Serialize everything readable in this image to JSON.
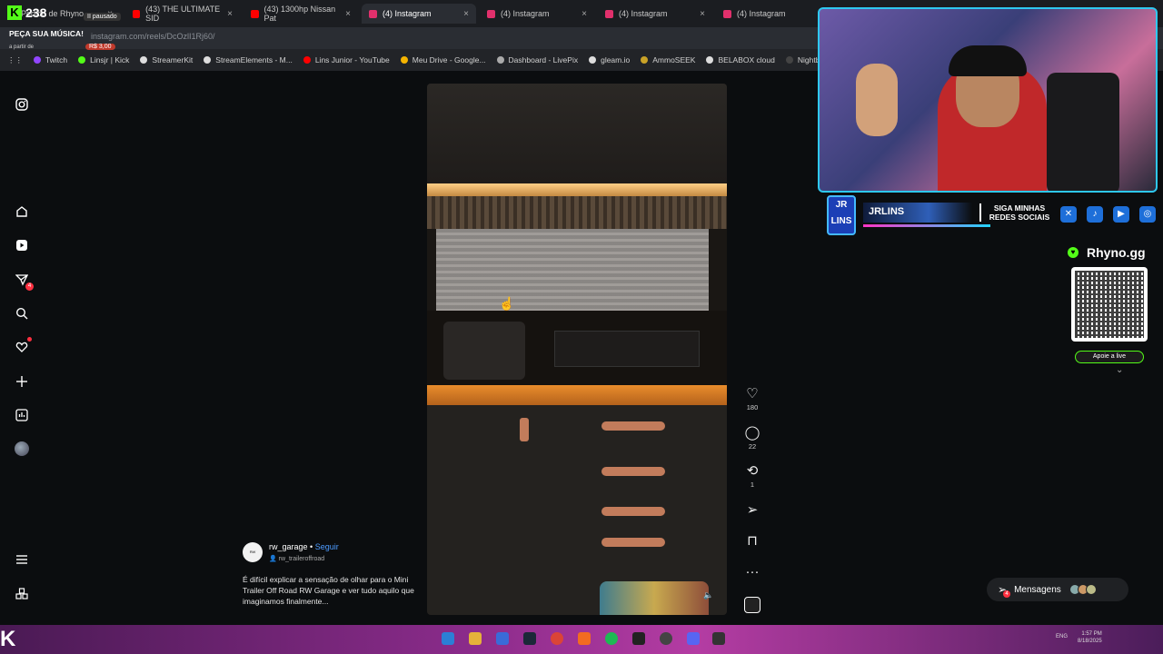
{
  "tabs": [
    {
      "label": "Pedido de Rhyno",
      "color": "#53fc18",
      "active": false
    },
    {
      "label": "(43) THE ULTIMATE SID",
      "color": "#ff0000",
      "active": false
    },
    {
      "label": "(43) 1300hp Nissan Pat",
      "color": "#ff0000",
      "active": false
    },
    {
      "label": "(4) Instagram",
      "color": "#e1306c",
      "active": true
    },
    {
      "label": "(4) Instagram",
      "color": "#e1306c",
      "active": false
    },
    {
      "label": "(4) Instagram",
      "color": "#e1306c",
      "active": false
    },
    {
      "label": "(4) Instagram",
      "color": "#e1306c",
      "active": false
    }
  ],
  "url": "instagram.com/reels/DcOzlI1Rj60/",
  "bookmarks": [
    "Twitch",
    "Linsjr | Kick",
    "StreamerKit",
    "StreamElements - M...",
    "Lins Junior - YouTube",
    "Meu Drive - Google...",
    "Dashboard - LivePix",
    "gleam.io",
    "AmmoSEEK",
    "BELABOX cloud",
    "Nightbot - Comm"
  ],
  "kick": {
    "count": "238",
    "sub": "Rhyno",
    "paused": "II pausado",
    "ask": "PEÇA SUA MÚSICA!",
    "from": "a partir de",
    "price": "R$ 3,00"
  },
  "reel": {
    "likes": "180",
    "comments": "22",
    "reposts": "1",
    "author": "rw_garage",
    "separator": " • ",
    "follow": "Seguir",
    "audio": "rw_traileroffroad",
    "avatar_text": "RW GARAGE",
    "caption": "É difícil explicar a sensação de olhar para o Mini Trailer Off Road RW Garage e ver tudo aquilo que imaginamos finalmente..."
  },
  "overlay": {
    "logo": "JR LINS",
    "name": "JRLINS",
    "follow_text": "SIGA MINHAS REDES SOCIAIS",
    "rhyno": "Rhyno.gg",
    "support": "Apoie a live"
  },
  "messages": {
    "label": "Mensagens",
    "badge": "4"
  },
  "notif_badge": "4",
  "tray": {
    "lang": "ENG",
    "time": "1:57 PM",
    "date": "8/18/2025"
  },
  "colors": {
    "accent": "#4d9bff",
    "kick": "#53fc18",
    "badge": "#ff3040"
  }
}
